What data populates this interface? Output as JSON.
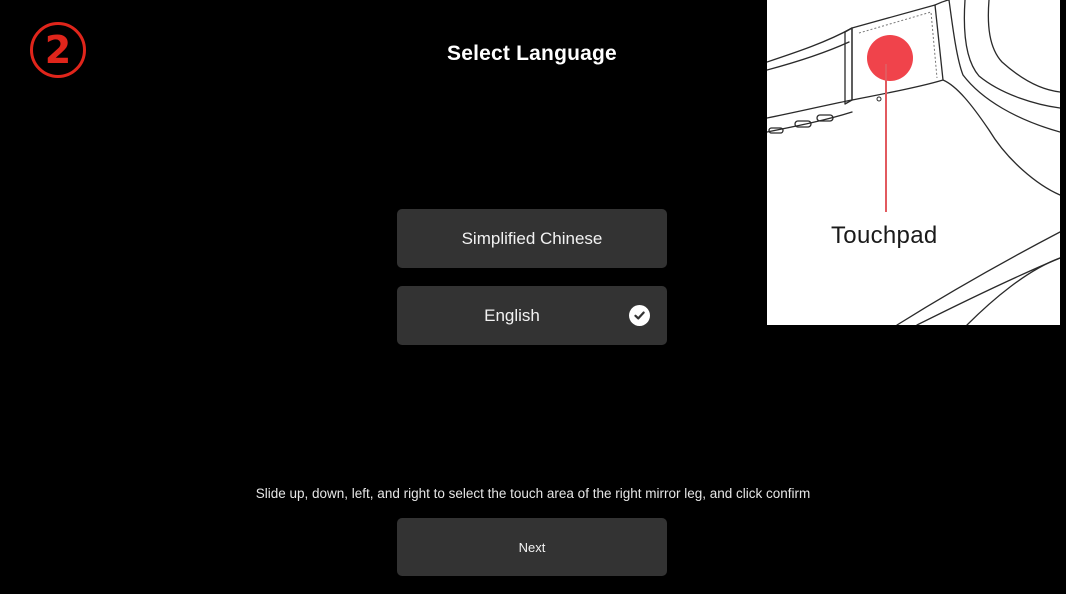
{
  "step": {
    "number": "2",
    "color": "#e0251b"
  },
  "header": {
    "title": "Select Language"
  },
  "languages": {
    "items": [
      {
        "label": "Simplified Chinese",
        "selected": false
      },
      {
        "label": "English",
        "selected": true,
        "icon": "check-circle-icon"
      }
    ]
  },
  "instruction": {
    "text": "Slide up, down, left, and right to select the touch area of the right mirror leg, and click confirm"
  },
  "footer": {
    "next_label": "Next"
  },
  "illustration": {
    "callout_label": "Touchpad",
    "highlight_color": "#f0434b",
    "icon": "glasses-temple-illustration"
  },
  "colors": {
    "background": "#000000",
    "button_background": "#333333",
    "accent_red": "#e0251b"
  }
}
